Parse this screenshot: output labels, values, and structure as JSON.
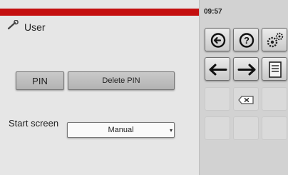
{
  "header": {
    "title": "User",
    "time": "09:57"
  },
  "buttons": {
    "pin_label": "PIN",
    "delete_pin_label": "Delete PIN"
  },
  "start_screen": {
    "label": "Start screen",
    "selected": "Manual"
  },
  "keypad": {
    "row1": [
      "back-circle-icon",
      "help-icon",
      "settings-gears-icon"
    ],
    "row2": [
      "arrow-left-icon",
      "arrow-right-icon",
      "save-disk-icon"
    ],
    "row3": [
      "",
      "backspace-icon",
      ""
    ],
    "row4": [
      "",
      "",
      ""
    ]
  },
  "colors": {
    "header_bar": "#c40f0f",
    "panel_bg": "#e6e6e6",
    "keypad_bg": "#d2d2d2"
  }
}
